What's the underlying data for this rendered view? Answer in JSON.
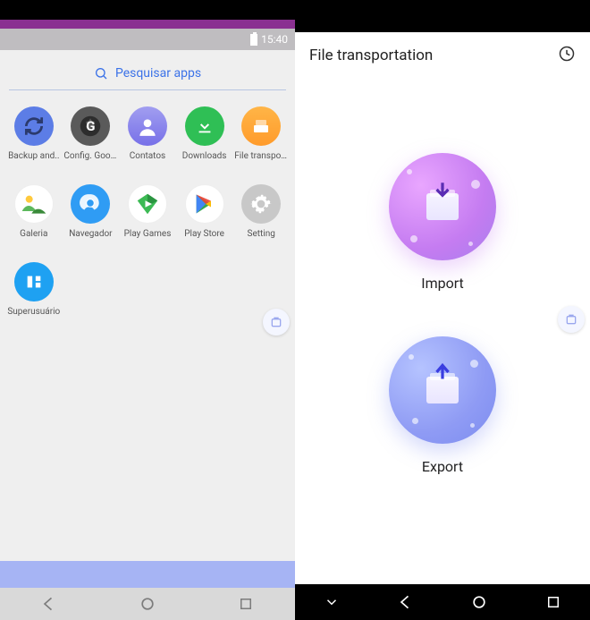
{
  "left": {
    "status": {
      "time": "15:40"
    },
    "search": {
      "placeholder": "Pesquisar apps"
    },
    "apps": [
      {
        "label": "Backup and..",
        "icon": "backup"
      },
      {
        "label": "Config. Goog..",
        "icon": "google-settings"
      },
      {
        "label": "Contatos",
        "icon": "contacts"
      },
      {
        "label": "Downloads",
        "icon": "downloads"
      },
      {
        "label": "File transpor..",
        "icon": "file-transport"
      },
      {
        "label": "Galeria",
        "icon": "gallery"
      },
      {
        "label": "Navegador",
        "icon": "browser"
      },
      {
        "label": "Play Games",
        "icon": "play-games"
      },
      {
        "label": "Play Store",
        "icon": "play-store"
      },
      {
        "label": "Setting",
        "icon": "settings"
      },
      {
        "label": "Superusuário",
        "icon": "superuser"
      }
    ]
  },
  "right": {
    "title": "File transportation",
    "actions": {
      "import_label": "Import",
      "export_label": "Export"
    }
  }
}
